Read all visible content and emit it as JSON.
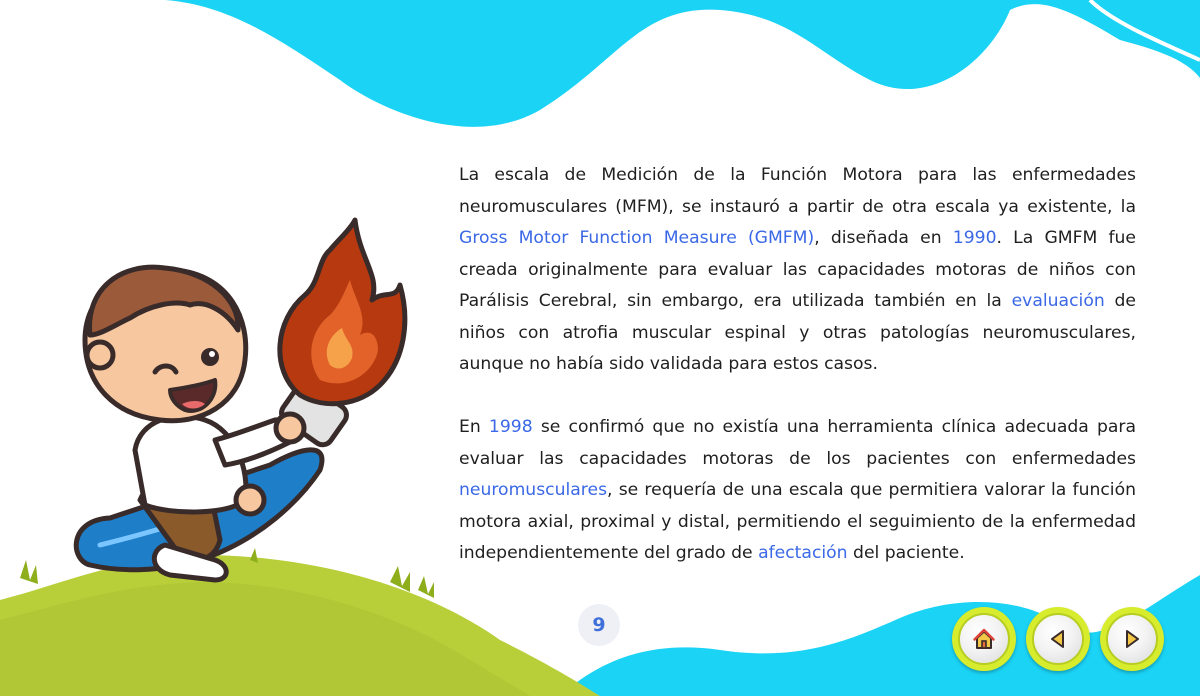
{
  "content": {
    "paragraph1": [
      {
        "text": "La escala de Medición de la Función Motora para las enfermedades neuromusculares (MFM), se instauró a partir de otra escala ya existente, la ",
        "link": false
      },
      {
        "text": "Gross Motor Function Measure (GMFM)",
        "link": true
      },
      {
        "text": ", diseñada en ",
        "link": false
      },
      {
        "text": "1990",
        "link": true
      },
      {
        "text": ". La GMFM fue creada originalmente para evaluar las capacidades motoras de niños con Parálisis Cerebral, sin embargo, era utilizada también en la ",
        "link": false
      },
      {
        "text": "evaluación",
        "link": true
      },
      {
        "text": " de niños con atrofia muscular espinal y otras patologías neuromusculares, aunque no había sido validada para estos casos.",
        "link": false
      }
    ],
    "paragraph2": [
      {
        "text": "En ",
        "link": false
      },
      {
        "text": "1998",
        "link": true
      },
      {
        "text": " se confirmó que no existía una herramienta clínica adecuada para evaluar las capacidades motoras de los pacientes con enfermedades ",
        "link": false
      },
      {
        "text": "neuromusculares",
        "link": true
      },
      {
        "text": ", se requería de una escala que permitiera valorar la función motora axial, proximal y distal, permitiendo el seguimiento de la enfermedad independientemente del grado de ",
        "link": false
      },
      {
        "text": "afectación",
        "link": true
      },
      {
        "text": " del paciente.",
        "link": false
      }
    ]
  },
  "page_number": "9",
  "navigation": {
    "home_icon": "home-icon",
    "prev_icon": "triangle-left-icon",
    "next_icon": "triangle-right-icon"
  },
  "colors": {
    "wave_blue": "#1bd3f5",
    "link_blue": "#3a68e6",
    "grass_green": "#b8cf3a",
    "button_lime": "#d6ec2d"
  }
}
